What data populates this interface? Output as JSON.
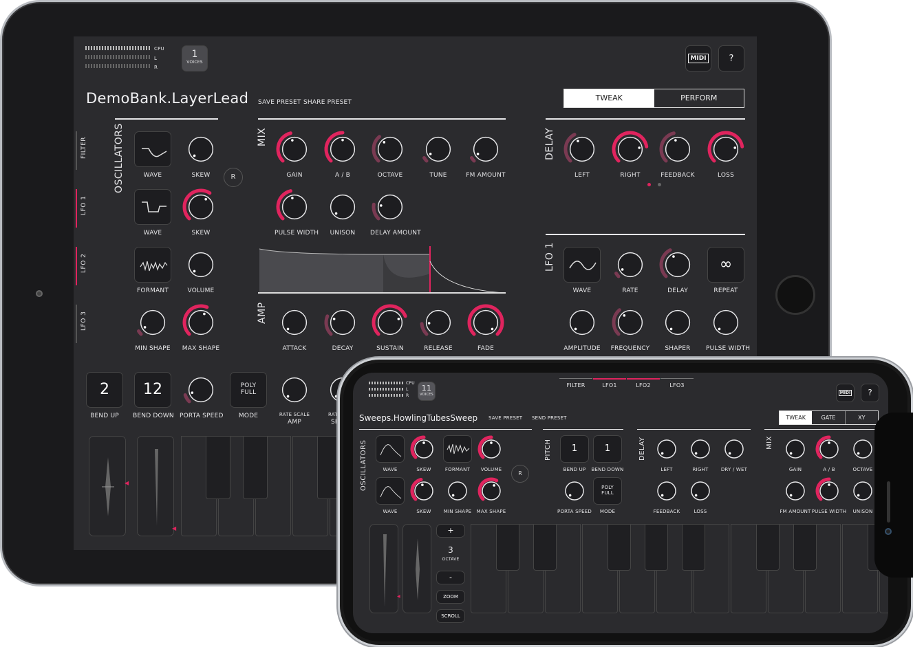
{
  "ipad": {
    "meters": {
      "cpu": "CPU",
      "l": "L",
      "r": "R"
    },
    "voices": {
      "count": "1",
      "label": "VOICES"
    },
    "midi_label": "MIDI",
    "help_label": "?",
    "preset_name": "DemoBank.LayerLead",
    "save_preset": "SAVE PRESET",
    "share_preset": "SHARE PRESET",
    "mode_tabs": [
      "TWEAK",
      "PERFORM"
    ],
    "side_tabs": [
      "FILTER",
      "LFO 1",
      "LFO 2",
      "LFO 3"
    ],
    "oscillators": {
      "title": "OSCILLATORS",
      "labels": [
        "WAVE",
        "SKEW",
        "WAVE",
        "SKEW",
        "FORMANT",
        "VOLUME",
        "MIN SHAPE",
        "MAX SHAPE"
      ],
      "reset": "R"
    },
    "mix": {
      "title": "MIX",
      "labels": [
        "GAIN",
        "A / B",
        "OCTAVE",
        "TUNE",
        "FM AMOUNT",
        "PULSE WIDTH",
        "UNISON",
        "DELAY AMOUNT"
      ]
    },
    "amp": {
      "title": "AMP",
      "labels": [
        "ATTACK",
        "DECAY",
        "SUSTAIN",
        "RELEASE",
        "FADE"
      ]
    },
    "delay": {
      "title": "DELAY",
      "labels": [
        "LEFT",
        "RIGHT",
        "FEEDBACK",
        "LOSS"
      ]
    },
    "lfo": {
      "title": "LFO 1",
      "labels": [
        "WAVE",
        "RATE",
        "DELAY",
        "REPEAT",
        "AMPLITUDE",
        "FREQUENCY",
        "SHAPER",
        "PULSE WIDTH"
      ],
      "repeat_symbol": "∞"
    },
    "bottom": {
      "bend_up": "2",
      "bend_up_label": "BEND UP",
      "bend_down": "12",
      "bend_down_label": "BEND DOWN",
      "porta_label": "PORTA SPEED",
      "mode_value_1": "POLY",
      "mode_value_2": "FULL",
      "mode_label": "MODE",
      "rate_scale_1": "RATE SCALE",
      "rate_scale_2": "AMP",
      "rate_partial": "RAT",
      "rate_partial_2": "SH"
    }
  },
  "phone": {
    "meters": {
      "cpu": "CPU",
      "l": "L",
      "r": "R"
    },
    "voices": {
      "count": "11",
      "label": "VOICES"
    },
    "top_tabs": [
      "FILTER",
      "LFO1",
      "LFO2",
      "LFO3"
    ],
    "midi_label": "MIDI",
    "help_label": "?",
    "preset_name": "Sweeps.HowlingTubesSweep",
    "save_preset": "SAVE PRESET",
    "send_preset": "SEND PRESET",
    "mode_tabs": [
      "TWEAK",
      "GATE",
      "XY"
    ],
    "oscillators": {
      "title": "OSCILLATORS",
      "labels": [
        "WAVE",
        "SKEW",
        "FORMANT",
        "VOLUME",
        "WAVE",
        "SKEW",
        "MIN SHAPE",
        "MAX SHAPE"
      ],
      "reset": "R"
    },
    "pitch": {
      "title": "PITCH",
      "bend_up": "1",
      "bend_down": "1",
      "labels": [
        "BEND UP",
        "BEND DOWN",
        "PORTA SPEED",
        "MODE"
      ],
      "mode_1": "POLY",
      "mode_2": "FULL"
    },
    "delay": {
      "title": "DELAY",
      "labels": [
        "LEFT",
        "RIGHT",
        "DRY / WET",
        "FEEDBACK",
        "LOSS"
      ]
    },
    "mix": {
      "title": "MIX",
      "labels": [
        "GAIN",
        "A / B",
        "OCTAVE",
        "FM AMOUNT",
        "PULSE WIDTH",
        "UNISON"
      ]
    },
    "keyboard": {
      "plus": "+",
      "octave": "3",
      "octave_label": "OCTAVE",
      "minus": "-",
      "zoom": "ZOOM",
      "scroll": "SCROLL"
    }
  },
  "colors": {
    "accent": "#e0245e",
    "bg": "#2b2b2e",
    "text": "#e6e6e8"
  }
}
